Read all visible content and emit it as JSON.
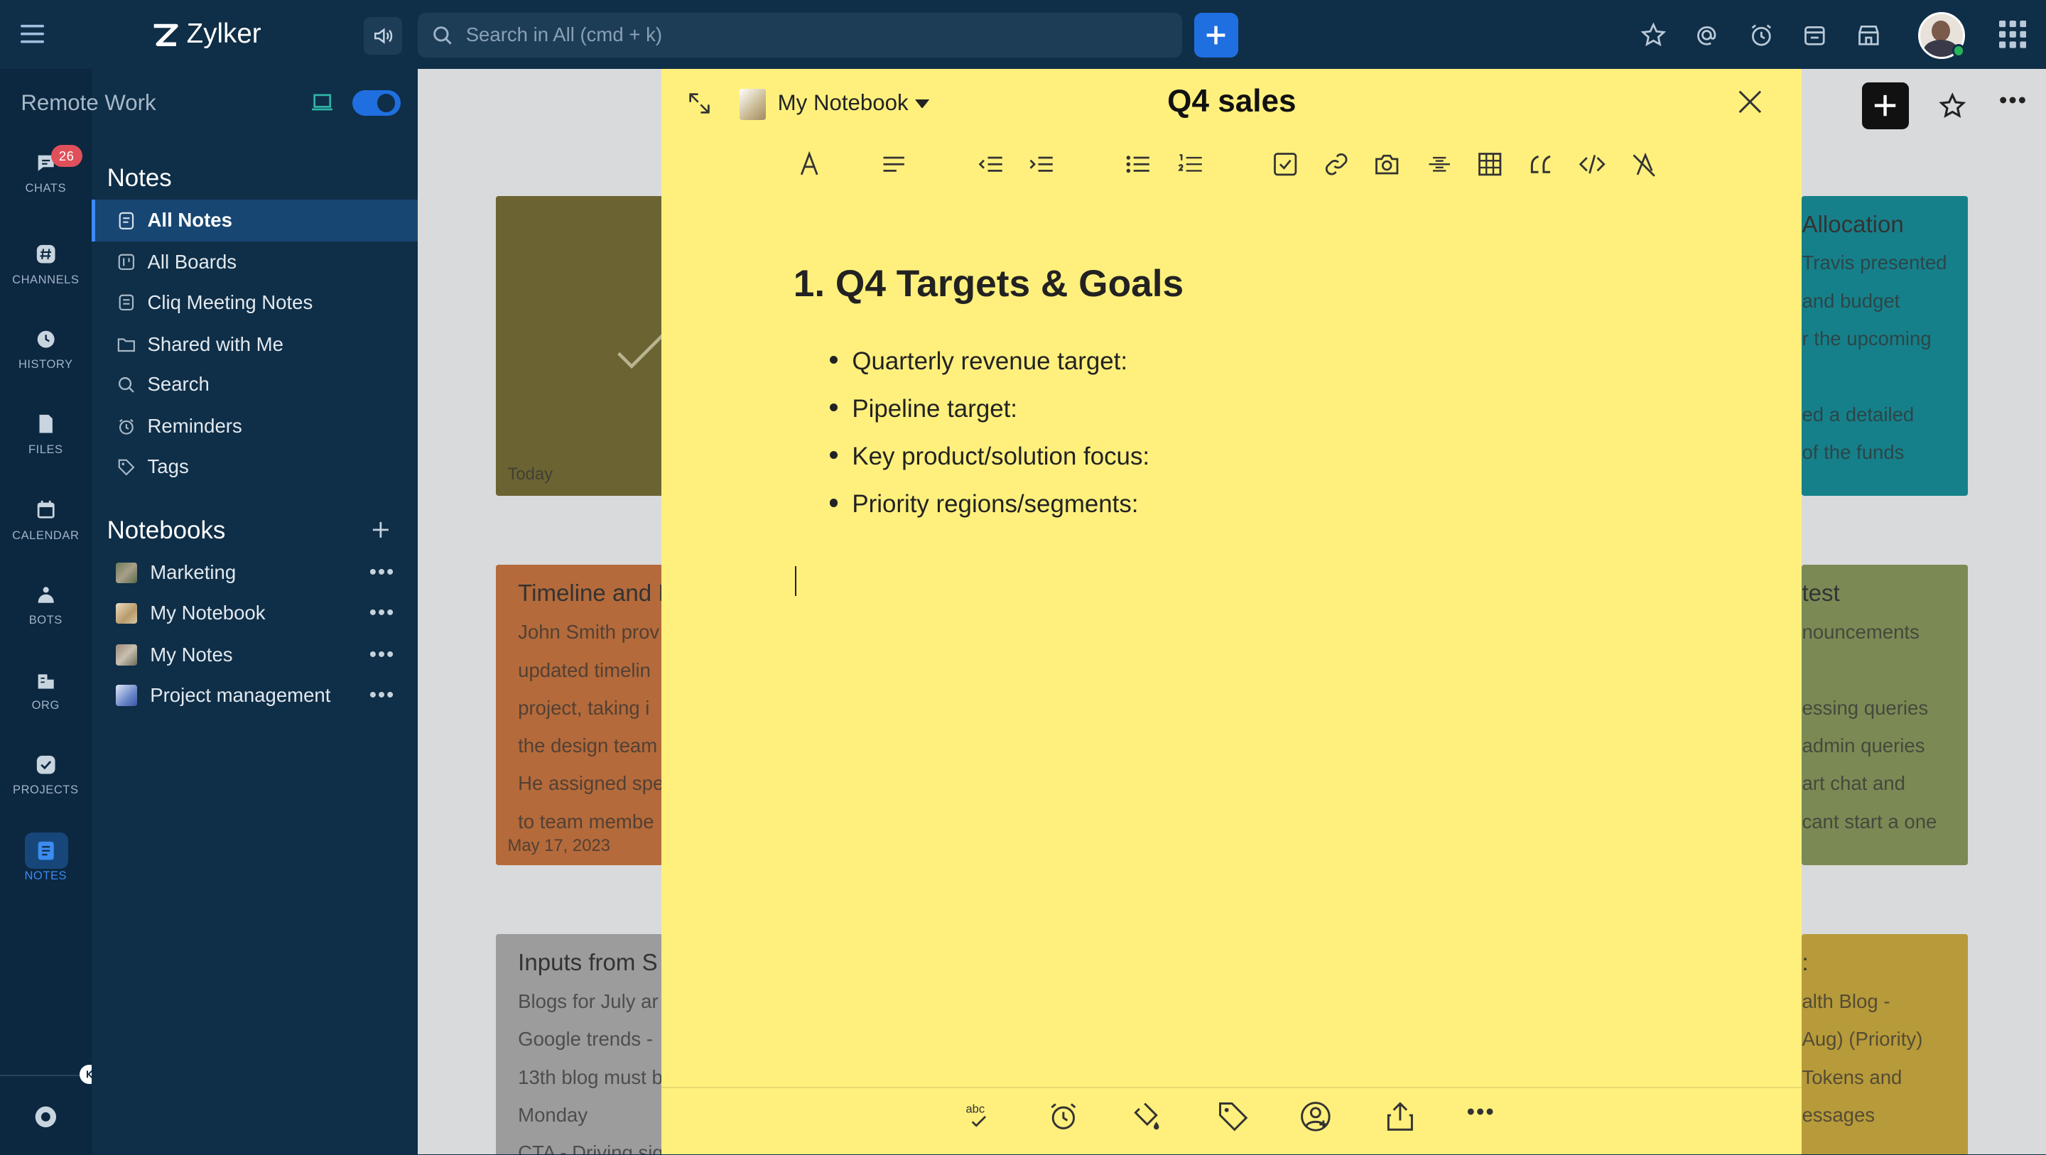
{
  "app": {
    "name": "Zylker",
    "search_placeholder": "Search in All (cmd + k)"
  },
  "workspace": {
    "name": "Remote Work"
  },
  "rail": [
    {
      "label": "CHATS",
      "icon": "chat-icon",
      "badge": "26"
    },
    {
      "label": "CHANNELS",
      "icon": "hash-icon"
    },
    {
      "label": "HISTORY",
      "icon": "history-icon"
    },
    {
      "label": "FILES",
      "icon": "file-icon"
    },
    {
      "label": "CALENDAR",
      "icon": "calendar-icon"
    },
    {
      "label": "BOTS",
      "icon": "bot-icon"
    },
    {
      "label": "ORG",
      "icon": "org-icon"
    },
    {
      "label": "PROJECTS",
      "icon": "projects-icon"
    },
    {
      "label": "NOTES",
      "icon": "notes-icon",
      "active": true
    }
  ],
  "sidebar": {
    "notes_heading": "Notes",
    "nav": [
      {
        "label": "All Notes",
        "icon": "notes-icon",
        "active": true
      },
      {
        "label": "All Boards",
        "icon": "boards-icon"
      },
      {
        "label": "Cliq Meeting Notes",
        "icon": "meeting-notes-icon"
      },
      {
        "label": "Shared with Me",
        "icon": "shared-folder-icon"
      },
      {
        "label": "Search",
        "icon": "search-icon"
      },
      {
        "label": "Reminders",
        "icon": "alarm-icon"
      },
      {
        "label": "Tags",
        "icon": "tag-icon"
      }
    ],
    "notebooks_heading": "Notebooks",
    "notebooks": [
      {
        "label": "Marketing",
        "color": "#8a8f6a"
      },
      {
        "label": "My Notebook",
        "color": "#c9b48a"
      },
      {
        "label": "My Notes",
        "color": "#8f8a7a"
      },
      {
        "label": "Project management",
        "color": "#7a90c8"
      }
    ]
  },
  "background_cards": {
    "card1": {
      "date": "Today"
    },
    "card2": {
      "title": "Allocation",
      "lines": [
        "Travis presented",
        "and budget",
        "r the upcoming",
        "ed a detailed",
        "of the funds"
      ]
    },
    "card3": {
      "title": "Timeline and I",
      "lines": [
        "John Smith prov",
        "updated timelin",
        "project, taking i",
        "the design team",
        "He assigned spe",
        "to team membe"
      ],
      "date": "May 17, 2023"
    },
    "card4": {
      "title": "test",
      "lines": [
        "nouncements",
        "essing queries",
        "admin queries",
        "art chat and",
        "cant start a one"
      ]
    },
    "card5": {
      "title": "Inputs from S",
      "lines": [
        "Blogs for July ar",
        "Google trends -",
        "13th blog must b",
        "Monday",
        "CTA - Driving sig"
      ]
    },
    "card6": {
      "title": ":",
      "lines": [
        "alth Blog -",
        "Aug) (Priority)",
        "Tokens and",
        "essages"
      ]
    }
  },
  "note": {
    "notebook": "My Notebook",
    "title": "Q4 sales",
    "heading": "1. Q4 Targets & Goals",
    "bullets": [
      "Quarterly revenue target:",
      "Pipeline target:",
      "Key product/solution focus:",
      "Priority regions/segments:"
    ],
    "colors": {
      "background": "#fff07d"
    }
  },
  "colors": {
    "accent": "#1f6fe0",
    "sidebar": "#0f2e47",
    "rail": "#0c2740",
    "badge": "#e0505b"
  }
}
